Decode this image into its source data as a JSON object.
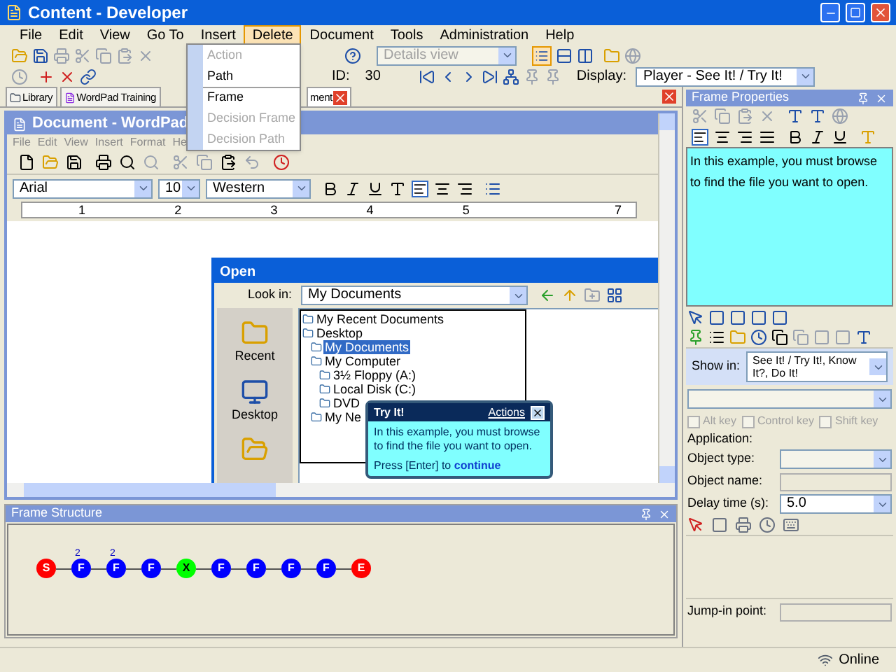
{
  "window": {
    "title": "Content - Developer"
  },
  "menu": [
    {
      "label": "File",
      "selected": false
    },
    {
      "label": "Edit",
      "selected": false
    },
    {
      "label": "View",
      "selected": false
    },
    {
      "label": "Go To",
      "selected": false
    },
    {
      "label": "Insert",
      "selected": false
    },
    {
      "label": "Delete",
      "selected": true
    },
    {
      "label": "Document",
      "selected": false
    },
    {
      "label": "Tools",
      "selected": false
    },
    {
      "label": "Administration",
      "selected": false
    },
    {
      "label": "Help",
      "selected": false
    }
  ],
  "delete_menu": [
    {
      "label": "Action",
      "disabled": true
    },
    {
      "label": "Path",
      "disabled": false
    },
    {
      "label": "Frame",
      "disabled": false
    },
    {
      "label": "Decision Frame",
      "disabled": true
    },
    {
      "label": "Decision Path",
      "disabled": true
    }
  ],
  "toolbar": {
    "view_select": {
      "value": "Details view",
      "disabled": true
    },
    "id_label": "ID:",
    "id_value": "30",
    "display_label": "Display:",
    "display_value": "Player - See It! / Try It!"
  },
  "doc_tabs": [
    {
      "label": "Library",
      "selected": false
    },
    {
      "label": "WordPad Training",
      "selected": false
    },
    {
      "label": "ment",
      "selected": true
    }
  ],
  "wordpad": {
    "title": "Document - WordPad",
    "menu": [
      "File",
      "Edit",
      "View",
      "Insert",
      "Format",
      "He"
    ],
    "font": "Arial",
    "size": "10",
    "script": "Western",
    "ruler": [
      "1",
      "2",
      "3",
      "4",
      "5",
      "7"
    ]
  },
  "open_dialog": {
    "title": "Open",
    "look_in_label": "Look in:",
    "look_in_value": "My Documents",
    "places": [
      "Recent",
      "Desktop"
    ],
    "locations": [
      {
        "label": "My Recent Documents",
        "selected": false
      },
      {
        "label": "Desktop",
        "selected": false,
        "children": [
          {
            "label": "My Documents",
            "selected": true
          },
          {
            "label": "My Computer",
            "selected": false,
            "children": [
              {
                "label": "3½ Floppy (A:)",
                "selected": false
              },
              {
                "label": "Local Disk (C:)",
                "selected": false
              },
              {
                "label": "DVD",
                "selected": false
              }
            ]
          },
          {
            "label": "My Ne",
            "selected": false
          }
        ]
      }
    ]
  },
  "callout": {
    "title": "Try It!",
    "link": "Actions",
    "text": "In this example, you must browse to find the file you want to open.",
    "prompt": "Press [Enter] to",
    "prompt_link": "continue"
  },
  "frame_structure": {
    "title": "Frame Structure",
    "nodes": [
      {
        "label": "S",
        "kind": "start",
        "color": "#ff0000"
      },
      {
        "label": "F",
        "kind": "frame",
        "color": "#0000ff",
        "count": "2"
      },
      {
        "label": "F",
        "kind": "frame",
        "color": "#0000ff",
        "count": "2"
      },
      {
        "label": "F",
        "kind": "frame",
        "color": "#0000ff"
      },
      {
        "label": "X",
        "kind": "decision",
        "color": "#00ff00"
      },
      {
        "label": "F",
        "kind": "frame",
        "color": "#0000ff"
      },
      {
        "label": "F",
        "kind": "frame",
        "color": "#0000ff"
      },
      {
        "label": "F",
        "kind": "frame",
        "color": "#0000ff"
      },
      {
        "label": "F",
        "kind": "frame",
        "color": "#0000ff"
      },
      {
        "label": "E",
        "kind": "end",
        "color": "#ff0000"
      }
    ]
  },
  "frame_properties": {
    "title": "Frame Properties",
    "text": "In this example, you must browse to find the file you want to open.",
    "show_in_label": "Show in:",
    "show_in_value": "See It! / Try It!, Know It?, Do It!",
    "modifiers": [
      {
        "label": "Alt key",
        "checked": false,
        "disabled": true
      },
      {
        "label": "Control key",
        "checked": false,
        "disabled": true
      },
      {
        "label": "Shift key",
        "checked": false,
        "disabled": true
      }
    ],
    "fields": [
      {
        "kind": "label",
        "label": "Application:"
      },
      {
        "kind": "select",
        "label": "Object type:",
        "disabled": true
      },
      {
        "kind": "input",
        "label": "Object name:",
        "disabled": true
      },
      {
        "kind": "select",
        "label": "Delay time (s):",
        "value": "5.0",
        "disabled": false
      }
    ],
    "jump_in_label": "Jump-in point:"
  },
  "status_bar": {
    "text": "Online"
  }
}
